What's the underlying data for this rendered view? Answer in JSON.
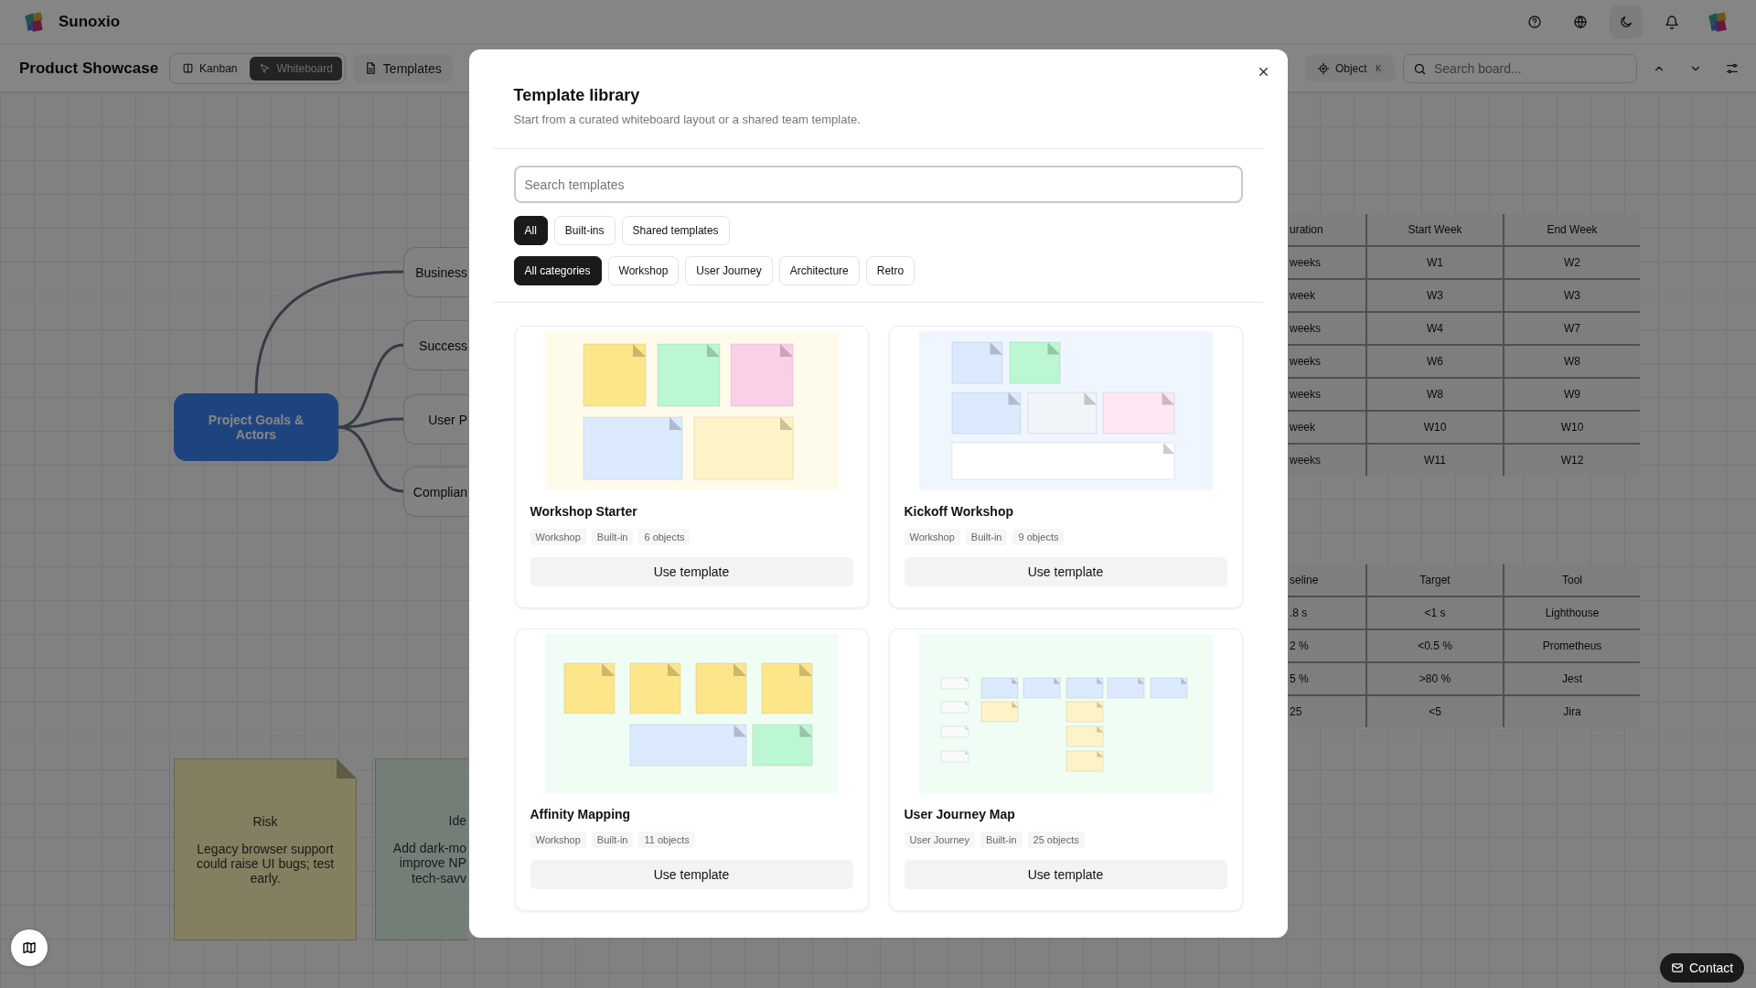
{
  "app": {
    "name": "Sunoxio"
  },
  "toolbar": {
    "board_title": "Product Showcase",
    "views": [
      {
        "label": "Kanban",
        "kind": "kanban",
        "selected": false
      },
      {
        "label": "Whiteboard",
        "kind": "whiteboard",
        "selected": true
      }
    ],
    "templates_button": "Templates",
    "object_button": {
      "label": "Object",
      "shortcut": "K"
    },
    "search": {
      "placeholder": "Search board..."
    }
  },
  "canvas": {
    "mind_map": {
      "root": "Project Goals & Actors",
      "children": [
        "Business",
        "Success",
        "User P",
        "Complian"
      ]
    },
    "notes": [
      {
        "title": "Risk",
        "text": "Legacy browser support could raise UI bugs; test early.",
        "kind": "risk"
      },
      {
        "title": "Ide",
        "lines": [
          "Add dark-mo",
          "improve NP",
          "tech-savv"
        ],
        "kind": "idea"
      }
    ],
    "tables": [
      {
        "columns": [
          "uration",
          "Start Week",
          "End Week"
        ],
        "rows": [
          [
            "weeks",
            "W1",
            "W2"
          ],
          [
            "week",
            "W3",
            "W3"
          ],
          [
            "weeks",
            "W4",
            "W7"
          ],
          [
            "weeks",
            "W6",
            "W8"
          ],
          [
            "weeks",
            "W8",
            "W9"
          ],
          [
            "week",
            "W10",
            "W10"
          ],
          [
            "weeks",
            "W11",
            "W12"
          ]
        ]
      },
      {
        "columns": [
          "seline",
          "Target",
          "Tool"
        ],
        "rows": [
          [
            ".8 s",
            "<1 s",
            "Lighthouse"
          ],
          [
            "2 %",
            "<0.5 %",
            "Prometheus"
          ],
          [
            "5 %",
            ">80 %",
            "Jest"
          ],
          [
            "25",
            "<5",
            "Jira"
          ]
        ]
      }
    ]
  },
  "modal": {
    "title": "Template library",
    "subtitle": "Start from a curated whiteboard layout or a shared team template.",
    "search": {
      "placeholder": "Search templates"
    },
    "sources": [
      {
        "label": "All",
        "selected": true
      },
      {
        "label": "Built-ins",
        "selected": false
      },
      {
        "label": "Shared templates",
        "selected": false
      }
    ],
    "categories": [
      {
        "label": "All categories",
        "selected": true
      },
      {
        "label": "Workshop",
        "selected": false
      },
      {
        "label": "User Journey",
        "selected": false
      },
      {
        "label": "Architecture",
        "selected": false
      },
      {
        "label": "Retro",
        "selected": false
      }
    ],
    "cards": [
      {
        "title": "Workshop Starter",
        "kind": "starter",
        "tags": [
          "Workshop",
          "Built-in",
          "6 objects"
        ],
        "action": "Use template"
      },
      {
        "title": "Kickoff Workshop",
        "kind": "kickoff",
        "tags": [
          "Workshop",
          "Built-in",
          "9 objects"
        ],
        "action": "Use template"
      },
      {
        "title": "Affinity Mapping",
        "kind": "affinity",
        "tags": [
          "Workshop",
          "Built-in",
          "11 objects"
        ],
        "action": "Use template"
      },
      {
        "title": "User Journey Map",
        "kind": "journey",
        "tags": [
          "User Journey",
          "Built-in",
          "25 objects"
        ],
        "action": "Use template"
      }
    ]
  },
  "contact_button": "Contact"
}
